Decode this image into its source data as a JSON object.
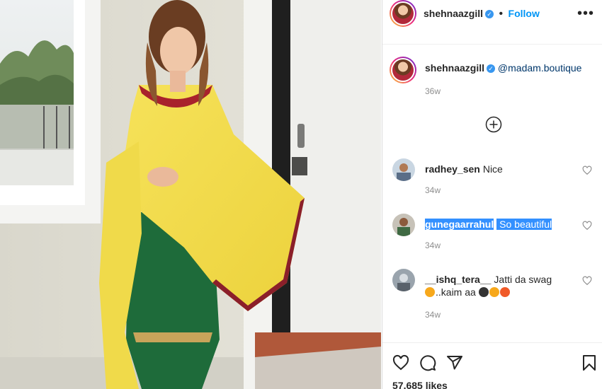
{
  "post": {
    "username": "shehnaazgill",
    "verified": true,
    "follow_label": "Follow",
    "separator": "•",
    "more_label": "•••"
  },
  "caption": {
    "username": "shehnaazgill",
    "mention": "@madam.boutique",
    "time": "36w"
  },
  "comments": [
    {
      "username": "radhey_sen",
      "text": "Nice",
      "time": "34w"
    },
    {
      "username": "gunegaarrahul",
      "text": "So beautiful",
      "time": "34w",
      "selected": true
    },
    {
      "username": "__ishq_tera__",
      "text": "Jatti da swag",
      "text2": "..kaim aa",
      "time": "34w"
    }
  ],
  "likes": {
    "text": "57,685 likes"
  },
  "icons": {
    "more": "more-options-icon",
    "load_more": "plus-circle-icon",
    "like": "heart-icon",
    "comment": "comment-icon",
    "share": "share-icon",
    "save": "bookmark-icon"
  },
  "colors": {
    "accent": "#0095f6",
    "verified": "#3897f0",
    "selection": "#3390ff",
    "muted": "#8e8e8e"
  }
}
